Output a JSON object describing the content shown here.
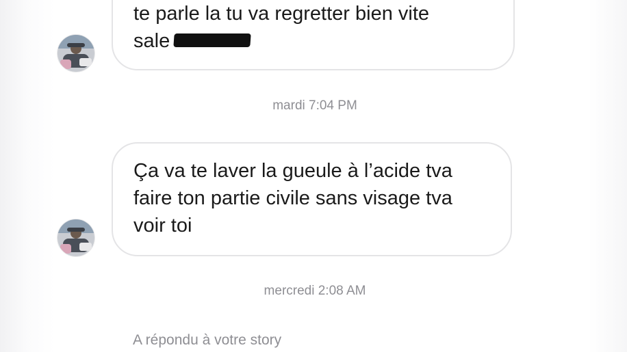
{
  "messages": [
    {
      "lines": [
        "te parle la tu va regretter bien vite",
        "sale"
      ]
    },
    {
      "lines": [
        "Ça va te laver la gueule à l’acide tva",
        "faire ton partie civile sans visage tva",
        "voir toi"
      ]
    }
  ],
  "timestamps": [
    "mardi 7:04 PM",
    "mercredi 2:08 AM"
  ],
  "story_reply_label": "A répondu à votre story",
  "colors": {
    "bubble_border": "#e4e4e6",
    "timestamp_text": "#8e8e93",
    "message_text": "#1a1a1a"
  }
}
